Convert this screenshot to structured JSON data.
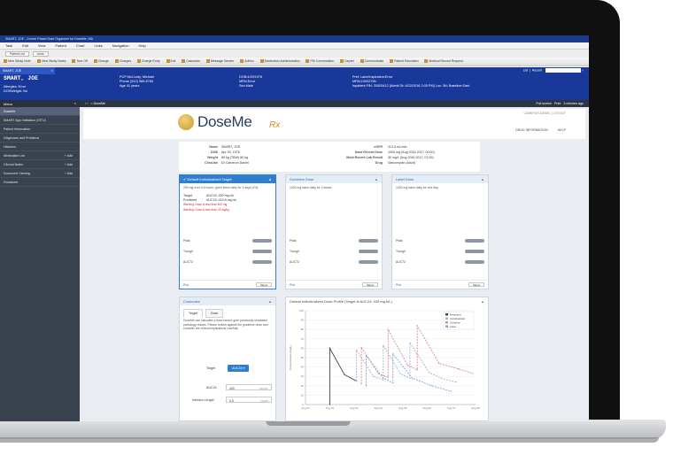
{
  "window": {
    "title": "SMART, JOE - Cerner PowerChart Organizer for DoseMe, MD",
    "menu": [
      "Task",
      "Edit",
      "View",
      "Patient",
      "Chart",
      "Links",
      "Navigation",
      "Help"
    ],
    "patient_list_tabs": [
      "Patient List",
      "Links"
    ],
    "toolbar": [
      "New Sticky Note",
      "View Sticky Notes",
      "Tear Off",
      "Change",
      "Charges",
      "Charge Entry",
      "Exit",
      "Calculator",
      "Message Sender",
      "AdHoc",
      "Medication Administration",
      "PM Conversation",
      "Depart",
      "Communicate",
      "Patient Education",
      "Medical Record Request"
    ]
  },
  "banner": {
    "patient_tab": "SMART, JOE",
    "list_label": "List",
    "recent_label": "Recent",
    "name": "SMART, JOE",
    "allergies": "Allergies: Error",
    "dose_weight": "DOSWeight: No",
    "col2": [
      "PCP:McCurdy, Michael",
      "Phone (512) 989-8765",
      "Age 41 years"
    ],
    "col3": [
      "DOB:4/29/1976",
      "MRN:Error",
      "Sex:Male"
    ],
    "col4": [
      "Pref: Lake/Inspiration:Error",
      "MRN:10002756",
      "Inpatient FIN: 20003412 [Admit Dt: 6/22/2016 2:05 PM] Loc: 3N; Baseline East"
    ]
  },
  "sidebar": {
    "header": "Menu",
    "items": [
      {
        "label": "DoseMe",
        "add": ""
      },
      {
        "label": "SMART App Validation (SITU)",
        "add": ""
      },
      {
        "label": "Patient Information",
        "add": ""
      },
      {
        "label": "Diagnoses and Problems",
        "add": ""
      },
      {
        "label": "Histories",
        "add": ""
      },
      {
        "label": "Medication List",
        "add": "+ Add"
      },
      {
        "label": "Clinical Notes",
        "add": "+ Add"
      },
      {
        "label": "Document Viewing",
        "add": "+ Add"
      },
      {
        "label": "Flowsheet",
        "add": ""
      }
    ]
  },
  "nav": {
    "title": "DoseMe",
    "right": [
      "Full screen",
      "Print",
      "3 minutes ago"
    ]
  },
  "doseme": {
    "logo": "DoseMe",
    "logo_rx": "Rx",
    "top_links": "CAMERON DANIEL  |  LOGOUT",
    "header_links": [
      "DRUG INFORMATION",
      "HELP"
    ],
    "patient": {
      "name_label": "Name",
      "name": "SMART, JOE",
      "dob_label": "DOB",
      "dob": "Apr 09, 1976",
      "weight_label": "Weight",
      "weight": "80 kg (TBW) 80 kg",
      "clinician_label": "Clinician",
      "clinician": "Dr Cameron Daniel",
      "egfr_label": "eGFR",
      "egfr": "113.5 mL/min",
      "recent_dose_label": "Most Recent Dose",
      "recent_dose": "1000 mg (Aug 2016 2017, 00:00)",
      "recent_lab_label": "Most Recent Lab Result",
      "recent_lab": "30 mg/L (Aug 2016 2017, 07:00)",
      "drug_label": "Drug",
      "drug": "Vancomycin (Adult)"
    },
    "cards": [
      {
        "title": "Default Individualized Target",
        "text": "250 mg over 0.5 hours, given twice daily for 3 days (4%)",
        "target_label": "Target",
        "target": "AUC24: 400 mg.h/L",
        "predicted_label": "Predicted",
        "predicted": "AUC24: 410.8 mg.h/L",
        "warnings": [
          "Warning: Dose is less than 500 mg",
          "Warning: Dose is less than 15 mg/kg"
        ],
        "metrics": [
          "Peak",
          "Trough",
          "AUC72"
        ],
        "plot": "Plot",
        "select": "Select"
      },
      {
        "title": "Guideline Dose",
        "text": "1000 mg twice daily for 3 doses",
        "metrics": [
          "Peak",
          "Trough",
          "AUC72"
        ],
        "plot": "Plot",
        "select": "Select"
      },
      {
        "title": "Label Dose",
        "text": "1000 mg twice daily for one day",
        "metrics": [
          "Peak",
          "Trough",
          "AUC72"
        ],
        "plot": "Plot",
        "select": "Select"
      }
    ],
    "customize": {
      "title": "Customize",
      "tabs": [
        "Target",
        "Dose"
      ],
      "text": "DoseMe can calculate a dose based upon previously simulated pathology results. Please review against the guideline dose and consider the clinical implications carefully.",
      "target_label": "Target",
      "target_button": "AUC24 ▾",
      "auc24_label": "AUC24",
      "auc24_value": "400",
      "auc24_unit": "mg.h/L",
      "interval_label": "Infusion Length",
      "interval_value": "0.5",
      "interval_unit": "hours"
    },
    "profile_title": "Default Individualized Dose Profile (Target is AUC24: 400 mg.h/L)"
  },
  "chart_data": {
    "type": "line",
    "title": "Default Individualized Dose Profile (Target is AUC24: 400 mg.h/L)",
    "ylabel": "Concentration (mg/L)",
    "ylim": [
      0,
      100
    ],
    "y_ticks": [
      0,
      10,
      20,
      30,
      40,
      50,
      60,
      70,
      80,
      90,
      100
    ],
    "x_ticks": [
      "Aug 01",
      "Aug 02",
      "Aug 03",
      "Aug 04",
      "Aug 05",
      "Aug 06",
      "Aug 07",
      "Aug 08"
    ],
    "xlim": [
      0,
      7
    ],
    "series": [
      {
        "name": "Measured",
        "color": "#3a3f4a",
        "dash": false,
        "points": [
          [
            1,
            0
          ],
          [
            1,
            60
          ],
          [
            1.6,
            32
          ],
          [
            2.1,
            25
          ]
        ]
      },
      {
        "name": "Individualized",
        "color": "#a5b6cf",
        "dash": true,
        "points": [
          [
            2.1,
            25
          ],
          [
            2.1,
            58
          ],
          [
            2.8,
            30
          ],
          [
            3.2,
            26
          ],
          [
            3.2,
            63
          ],
          [
            3.9,
            33
          ],
          [
            4.3,
            28
          ],
          [
            4.3,
            66
          ],
          [
            5.1,
            34
          ],
          [
            5.6,
            28
          ],
          [
            6.2,
            24
          ]
        ]
      },
      {
        "name": "Guideline",
        "color": "#d98c95",
        "dash": true,
        "points": [
          [
            2.3,
            22
          ],
          [
            2.3,
            61
          ],
          [
            3.0,
            33
          ],
          [
            3.4,
            29
          ],
          [
            3.4,
            80
          ],
          [
            4.2,
            42
          ],
          [
            4.6,
            37
          ],
          [
            4.6,
            84
          ],
          [
            5.5,
            44
          ],
          [
            6.3,
            38
          ],
          [
            6.9,
            33
          ]
        ]
      },
      {
        "name": "Label",
        "color": "#7fa7d6",
        "dash": true,
        "points": [
          [
            2.5,
            20
          ],
          [
            2.5,
            52
          ],
          [
            3.2,
            28
          ],
          [
            3.6,
            23
          ],
          [
            3.6,
            54
          ],
          [
            4.4,
            28
          ],
          [
            5.2,
            20
          ],
          [
            6.0,
            14
          ]
        ]
      }
    ],
    "legend": "top-right"
  }
}
